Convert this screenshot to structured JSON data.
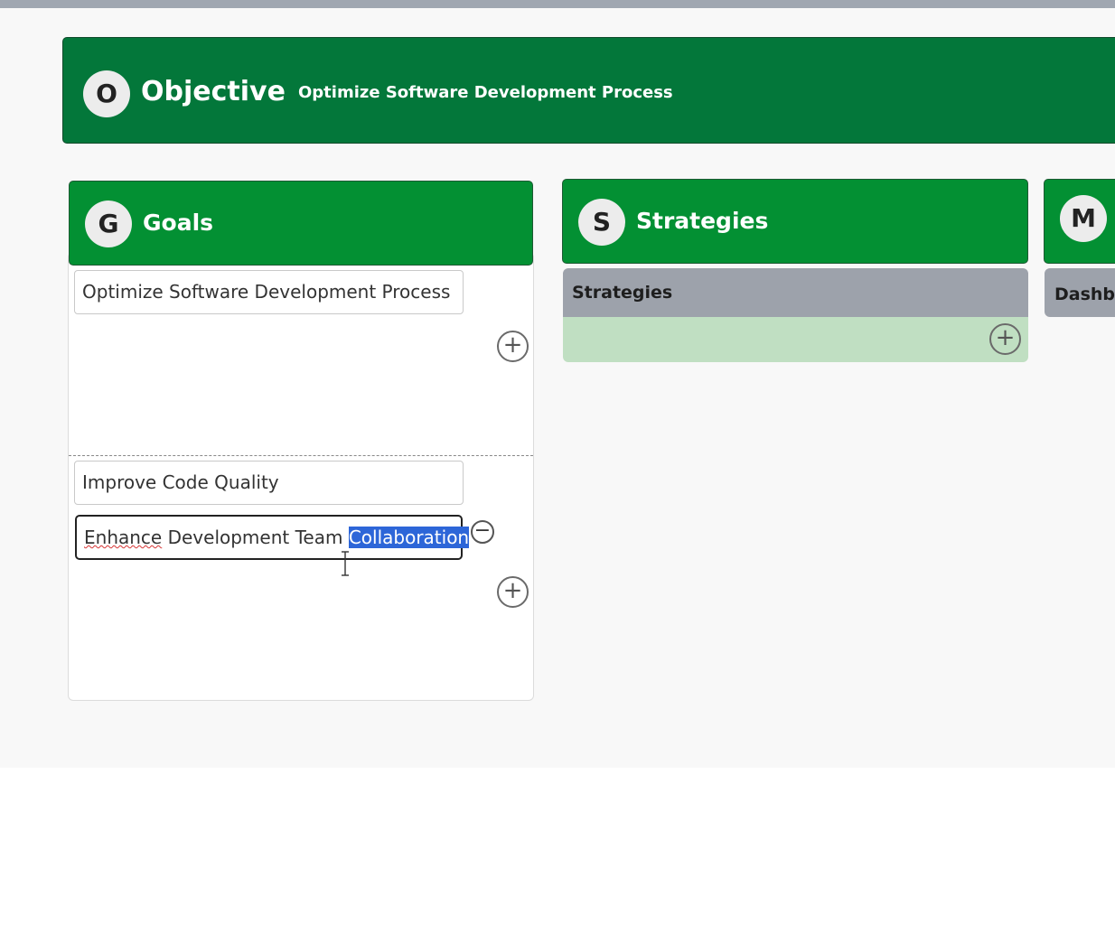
{
  "objective": {
    "badge": "O",
    "title": "Objective",
    "subtitle": "Optimize Software Development Process"
  },
  "columns": {
    "goals": {
      "badge": "G",
      "title": "Goals",
      "items": [
        "Optimize Software Development Process",
        "Improve Code Quality"
      ],
      "editing": {
        "word1": "Enhance",
        "word2": " Development Team ",
        "word3": "Collaboration",
        "selected_text": "Collaboration"
      }
    },
    "strategies": {
      "badge": "S",
      "title": "Strategies",
      "panel_title": "Strategies"
    },
    "metrics": {
      "badge": "M",
      "panel_title": "Dashbo"
    }
  },
  "icons": {
    "plus": "+",
    "minus": "−",
    "text_cursor": "I-beam"
  },
  "colors": {
    "objective_bg": "#03773a",
    "header_bg": "#039033",
    "panel_header_bg": "#9da2ab",
    "strategy_body_bg": "#c0dfc2",
    "selection": "#2d66d8"
  }
}
